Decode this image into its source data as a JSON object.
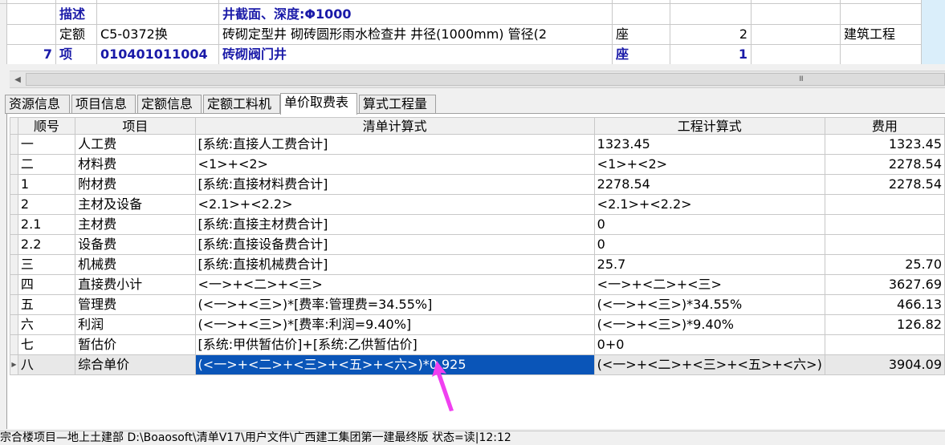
{
  "top_grid": {
    "rows": [
      {
        "c1": "",
        "c2": "",
        "c3": "",
        "c4": "",
        "c5": "",
        "c6": "",
        "c7": "",
        "c8": ""
      },
      {
        "c1": "",
        "c2": "描述",
        "c3": "",
        "c4": "井截面、深度:Φ1000",
        "c5": "",
        "c6": "",
        "c7": "",
        "c8": ""
      },
      {
        "c1": "",
        "c2": "定额",
        "c3": "C5-0372换",
        "c4": "砖砌定型井 砌砖圆形雨水检查井 井径(1000mm) 管径(2",
        "c5": "座",
        "c6": "2",
        "c7": "",
        "c8": "建筑工程"
      },
      {
        "c1": "7",
        "c2": "项",
        "c3": "010401011004",
        "c4": "砖砌阀门井",
        "c5": "座",
        "c6": "1",
        "c7": "",
        "c8": ""
      }
    ]
  },
  "scrollbar": {
    "grip": "III"
  },
  "tabs": [
    {
      "label": "资源信息"
    },
    {
      "label": "项目信息"
    },
    {
      "label": "定额信息"
    },
    {
      "label": "定额工料机"
    },
    {
      "label": "单价取费表",
      "active": true
    },
    {
      "label": "算式工程量"
    }
  ],
  "fee_table": {
    "headers": {
      "seq": "顺号",
      "item": "项目",
      "formula": "清单计算式",
      "calc": "工程计算式",
      "fee": "费用"
    },
    "rows": [
      {
        "seq": "一",
        "item": "人工费",
        "formula": "[系统:直接人工费合计]",
        "calc": "1323.45",
        "fee": "1323.45"
      },
      {
        "seq": "二",
        "item": "材料费",
        "formula": "<1>+<2>",
        "calc": "<1>+<2>",
        "fee": "2278.54"
      },
      {
        "seq": "1",
        "item": "附材费",
        "formula": "[系统:直接材料费合计]",
        "calc": "2278.54",
        "fee": "2278.54"
      },
      {
        "seq": "2",
        "item": "主材及设备",
        "formula": "<2.1>+<2.2>",
        "calc": "<2.1>+<2.2>",
        "fee": ""
      },
      {
        "seq": "2.1",
        "item": "主材费",
        "formula": "[系统:直接主材费合计]",
        "calc": "0",
        "fee": ""
      },
      {
        "seq": "2.2",
        "item": "设备费",
        "formula": "[系统:直接设备费合计]",
        "calc": "0",
        "fee": ""
      },
      {
        "seq": "三",
        "item": "机械费",
        "formula": "[系统:直接机械费合计]",
        "calc": "25.7",
        "fee": "25.70"
      },
      {
        "seq": "四",
        "item": "直接费小计",
        "formula": "<一>+<二>+<三>",
        "calc": "<一>+<二>+<三>",
        "fee": "3627.69"
      },
      {
        "seq": "五",
        "item": "管理费",
        "formula": "(<一>+<三>)*[费率:管理费=34.55%]",
        "calc": "(<一>+<三>)*34.55%",
        "fee": "466.13"
      },
      {
        "seq": "六",
        "item": "利润",
        "formula": "(<一>+<三>)*[费率:利润=9.40%]",
        "calc": "(<一>+<三>)*9.40%",
        "fee": "126.82"
      },
      {
        "seq": "七",
        "item": "暂估价",
        "formula": "[系统:甲供暂估价]+[系统:乙供暂估价]",
        "calc": "0+0",
        "fee": ""
      },
      {
        "seq": "八",
        "item": "综合单价",
        "formula": "(<一>+<二>+<三>+<五>+<六>)*0.925",
        "calc": "(<一>+<二>+<三>+<五>+<六>)",
        "fee": "3904.09",
        "selected": true
      }
    ]
  },
  "status_bar": {
    "text": "宗合楼项目—地上土建部 D:\\Boaosoft\\清单V17\\用户文件\\广西建工集团第一建最终版 状态=读|12:12"
  },
  "colors": {
    "selection": "#0a55b8",
    "annotation": "#f040f0",
    "bold_text": "#1a1aa8",
    "side_strip": "#daeefa"
  }
}
